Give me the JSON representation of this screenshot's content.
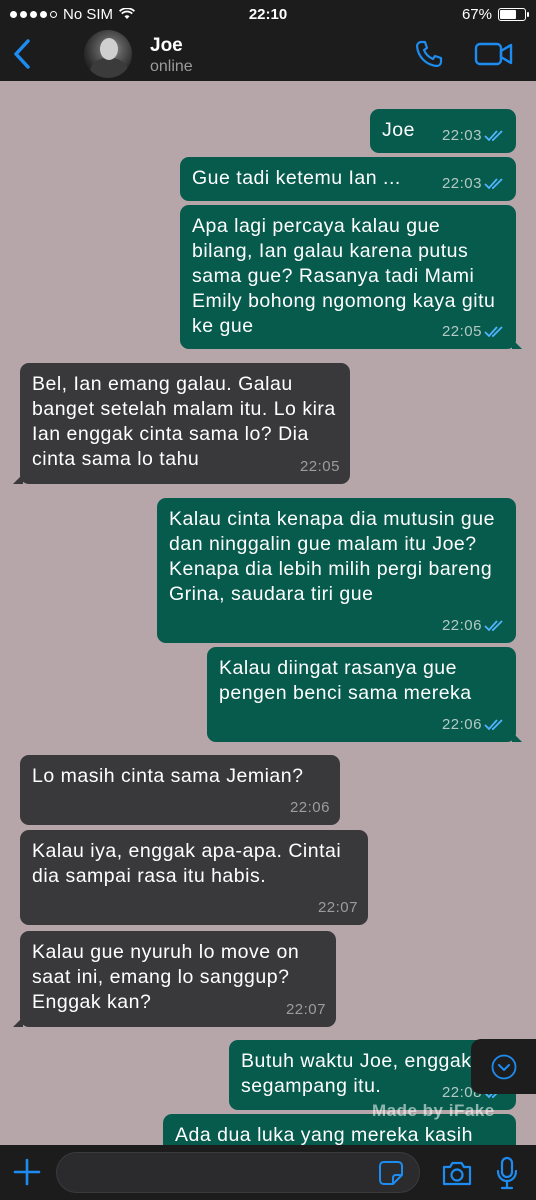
{
  "status_bar": {
    "carrier": "No SIM",
    "time": "22:10",
    "battery": "67%"
  },
  "header": {
    "name": "Joe",
    "status": "online"
  },
  "messages": [
    {
      "dir": "out",
      "text": "Joe",
      "time": "22:03",
      "read": true
    },
    {
      "dir": "out",
      "text": "Gue tadi ketemu Ian ...",
      "time": "22:03",
      "read": true
    },
    {
      "dir": "out",
      "text": "Apa lagi percaya kalau gue bilang, Ian galau karena putus sama gue? Rasanya tadi Mami Emily bohong ngomong kaya gitu ke gue",
      "time": "22:05",
      "read": true
    },
    {
      "dir": "in",
      "text": "Bel, Ian emang galau. Galau banget setelah malam itu. Lo kira Ian enggak cinta sama lo? Dia cinta sama lo tahu",
      "time": "22:05"
    },
    {
      "dir": "out",
      "text": "Kalau cinta kenapa dia mutusin gue dan ninggalin gue malam itu Joe? Kenapa dia lebih milih pergi bareng Grina, saudara tiri gue",
      "time": "22:06",
      "read": true
    },
    {
      "dir": "out",
      "text": "Kalau diingat rasanya gue pengen benci sama mereka",
      "time": "22:06",
      "read": true
    },
    {
      "dir": "in",
      "text": "Lo masih cinta sama Jemian?",
      "time": "22:06"
    },
    {
      "dir": "in",
      "text": "Kalau iya, enggak apa-apa. Cintai dia sampai rasa itu habis.",
      "time": "22:07"
    },
    {
      "dir": "in",
      "text": "Kalau gue nyuruh lo move on saat ini, emang lo sanggup? Enggak kan?",
      "time": "22:07"
    },
    {
      "dir": "out",
      "text": "Butuh waktu Joe, enggak segampang itu.",
      "time": "22:08",
      "read": true
    },
    {
      "dir": "out",
      "text": "Ada dua luka yang mereka kasih",
      "time": "",
      "read": false
    }
  ],
  "watermark": "Made by iFake",
  "input": {
    "placeholder": "",
    "value": ""
  },
  "colors": {
    "background": "#b7a6a9",
    "outgoing_bubble": "#065b4d",
    "incoming_bubble": "#39393b",
    "bars": "#1c1c1d",
    "accent": "#1d8cf0",
    "read_ticks": "#4fb3ff"
  },
  "icons": [
    "back-chevron-icon",
    "phone-icon",
    "video-camera-icon",
    "plus-icon",
    "sticker-icon",
    "camera-icon",
    "microphone-icon",
    "chevron-down-icon",
    "double-check-icon"
  ]
}
